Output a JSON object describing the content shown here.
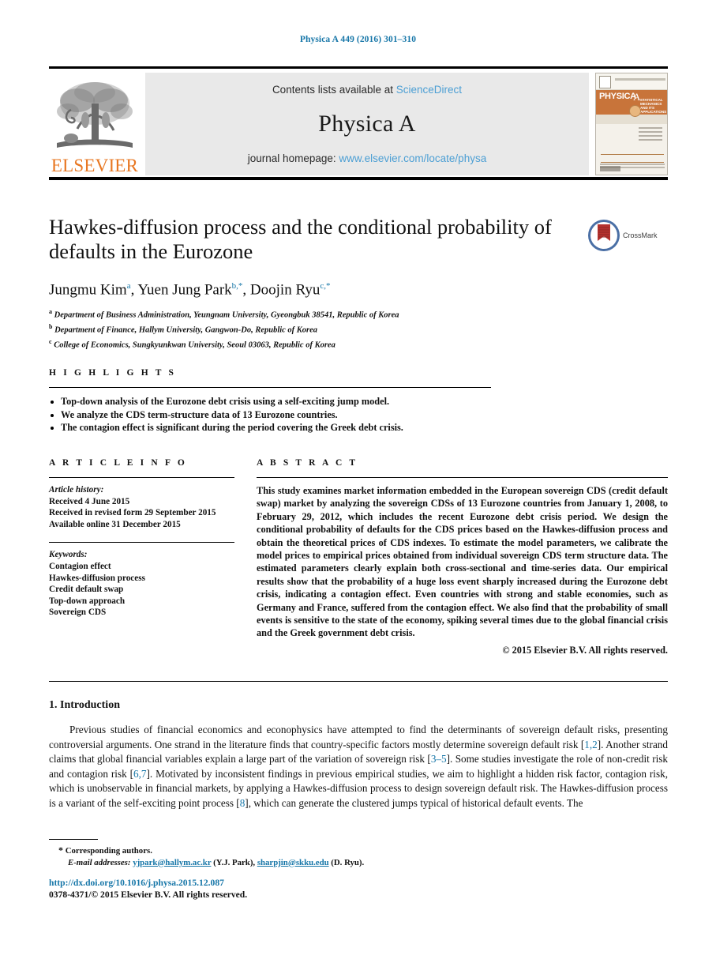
{
  "running_head": "Physica A 449 (2016) 301–310",
  "masthead": {
    "contents_prefix": "Contents lists available at ",
    "contents_link": "ScienceDirect",
    "journal_name": "Physica A",
    "homepage_prefix": "journal homepage: ",
    "homepage_link": "www.elsevier.com/locate/physa",
    "publisher": "ELSEVIER",
    "cover": {
      "band_title": "PHYSICA",
      "band_letter": "A",
      "band_subtitle": "STATISTICAL MECHANICS AND ITS APPLICATIONS"
    }
  },
  "title": "Hawkes-diffusion process and the conditional probability of defaults in the Eurozone",
  "crossmark_label": "CrossMark",
  "authors": [
    {
      "name": "Jungmu Kim",
      "marks": "a",
      "corresponding": false
    },
    {
      "name": "Yuen Jung Park",
      "marks": "b",
      "corresponding": true
    },
    {
      "name": "Doojin Ryu",
      "marks": "c",
      "corresponding": true
    }
  ],
  "affiliations": [
    {
      "mark": "a",
      "text": "Department of Business Administration, Yeungnam University, Gyeongbuk 38541, Republic of Korea"
    },
    {
      "mark": "b",
      "text": "Department of Finance, Hallym University, Gangwon-Do, Republic of Korea"
    },
    {
      "mark": "c",
      "text": "College of Economics, Sungkyunkwan University, Seoul 03063, Republic of Korea"
    }
  ],
  "highlights": {
    "label": "H I G H L I G H T S",
    "items": [
      "Top-down analysis of the Eurozone debt crisis using a self-exciting jump model.",
      "We analyze the CDS term-structure data of 13 Eurozone countries.",
      "The contagion effect is significant during the period covering the Greek debt crisis."
    ]
  },
  "article_info": {
    "label": "A R T I C L E    I N F O",
    "history_label": "Article history:",
    "history": [
      "Received 4 June 2015",
      "Received in revised form 29 September 2015",
      "Available online 31 December 2015"
    ],
    "keywords_label": "Keywords:",
    "keywords": [
      "Contagion effect",
      "Hawkes-diffusion process",
      "Credit default swap",
      "Top-down approach",
      "Sovereign CDS"
    ]
  },
  "abstract": {
    "label": "A B S T R A C T",
    "text": "This study examines market information embedded in the European sovereign CDS (credit default swap) market by analyzing the sovereign CDSs of 13 Eurozone countries from January 1, 2008, to February 29, 2012, which includes the recent Eurozone debt crisis period. We design the conditional probability of defaults for the CDS prices based on the Hawkes-diffusion process and obtain the theoretical prices of CDS indexes. To estimate the model parameters, we calibrate the model prices to empirical prices obtained from individual sovereign CDS term structure data. The estimated parameters clearly explain both cross-sectional and time-series data. Our empirical results show that the probability of a huge loss event sharply increased during the Eurozone debt crisis, indicating a contagion effect. Even countries with strong and stable economies, such as Germany and France, suffered from the contagion effect. We also find that the probability of small events is sensitive to the state of the economy, spiking several times due to the global financial crisis and the Greek government debt crisis.",
    "copyright": "© 2015 Elsevier B.V. All rights reserved."
  },
  "introduction": {
    "heading": "1. Introduction",
    "paragraph_1a": "Previous studies of financial economics and econophysics have attempted to find the determinants of sovereign default risks, presenting controversial arguments. One strand in the literature finds that country-specific factors mostly determine sovereign default risk [",
    "ref_1_2": "1,2",
    "paragraph_1b": "]. Another strand claims that global financial variables explain a large part of the variation of sovereign risk [",
    "ref_3_5": "3–5",
    "paragraph_1c": "]. Some studies investigate the role of non-credit risk and contagion risk [",
    "ref_6_7": "6,7",
    "paragraph_1d": "]. Motivated by inconsistent findings in previous empirical studies, we aim to highlight a hidden risk factor, contagion risk, which is unobservable in financial markets, by applying a Hawkes-diffusion process to design sovereign default risk. The Hawkes-diffusion process is a variant of the self-exciting point process [",
    "ref_8": "8",
    "paragraph_1e": "], which can generate the clustered jumps typical of historical default events. The"
  },
  "footnote": {
    "star": "*",
    "corresponding_text": "Corresponding authors.",
    "email_label": "E-mail addresses:",
    "email_1": "yjpark@hallym.ac.kr",
    "email_1_owner": "(Y.J. Park),",
    "email_2": "sharpjin@skku.edu",
    "email_2_owner": "(D. Ryu)."
  },
  "footer": {
    "doi": "http://dx.doi.org/10.1016/j.physa.2015.12.087",
    "issn": "0378-4371/© 2015 Elsevier B.V. All rights reserved."
  },
  "colors": {
    "link_blue": "#1676a8",
    "light_blue": "#4c9fd4",
    "elsevier_orange": "#e87722",
    "masthead_gray": "#e9e9e9"
  }
}
